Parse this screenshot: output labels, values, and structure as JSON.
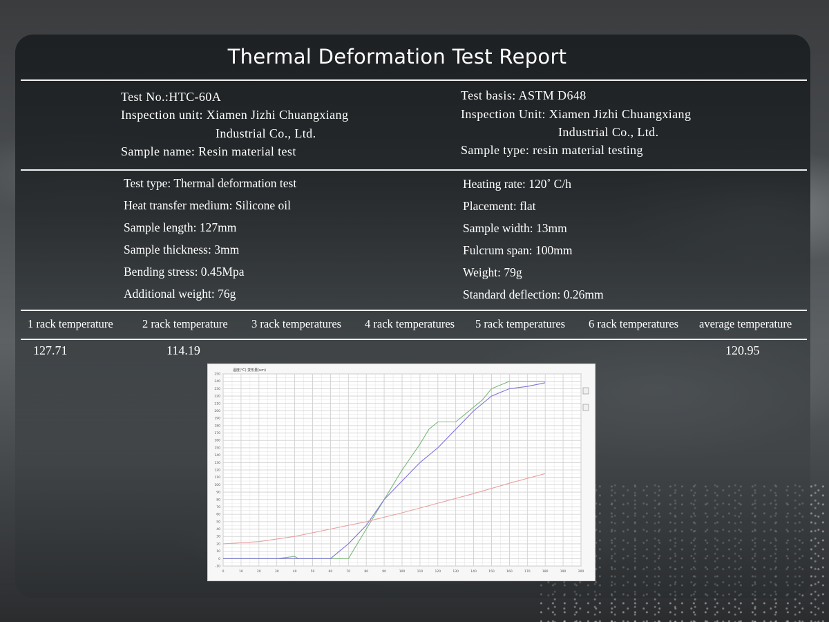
{
  "report": {
    "title": "Thermal Deformation Test Report",
    "header_left": {
      "test_no": "Test No.:HTC-60A",
      "inspection_unit_1": "Inspection unit: Xiamen Jizhi Chuangxiang",
      "inspection_unit_2": "Industrial Co., Ltd.",
      "sample_name": "Sample name: Resin material test"
    },
    "header_right": {
      "test_basis": "Test basis: ASTM D648",
      "inspection_unit_1": "Inspection Unit: Xiamen Jizhi Chuangxiang",
      "inspection_unit_2": "Industrial Co., Ltd.",
      "sample_type": "Sample type: resin material testing"
    },
    "params_left": [
      "Test type: Thermal deformation test",
      "Heat transfer medium: Silicone oil",
      "Sample length: 127mm",
      "Sample thickness: 3mm",
      "Bending stress: 0.45Mpa",
      "Additional weight: 76g"
    ],
    "params_right": [
      "Heating rate: 120˚ C/h",
      "Placement: flat",
      "Sample width: 13mm",
      "Fulcrum span: 100mm",
      "Weight: 79g",
      "Standard deflection: 0.26mm"
    ],
    "temperature_columns": [
      "1 rack temperature",
      "2 rack temperature",
      "3 rack temperatures",
      "4 rack temperatures",
      "5 rack temperatures",
      "6 rack temperatures",
      "average temperature"
    ],
    "temperature_values": {
      "rack1": "127.71",
      "rack2": "114.19",
      "average": "120.95"
    }
  },
  "chart_data": {
    "type": "line",
    "title": "温度(℃) 变形量(um)",
    "xlim": [
      0,
      200
    ],
    "ylim": [
      -10,
      250
    ],
    "x_ticks": [
      "0",
      "10",
      "20",
      "30",
      "40",
      "50",
      "60",
      "70",
      "80",
      "90",
      "100",
      "110",
      "120",
      "130",
      "140",
      "150",
      "160",
      "170",
      "180",
      "190",
      "200"
    ],
    "y_ticks": [
      "-10",
      "0",
      "10",
      "20",
      "30",
      "40",
      "50",
      "60",
      "70",
      "80",
      "90",
      "100",
      "110",
      "120",
      "130",
      "140",
      "150",
      "160",
      "170",
      "180",
      "190",
      "200",
      "210",
      "220",
      "230",
      "240",
      "250"
    ],
    "series": [
      {
        "color": "#7ab77a",
        "x": [
          0,
          30,
          40,
          42,
          60,
          70,
          80,
          90,
          100,
          110,
          115,
          120,
          130,
          140,
          145,
          150,
          160,
          170,
          180
        ],
        "y": [
          0,
          0,
          3,
          0,
          0,
          0,
          40,
          80,
          120,
          155,
          175,
          185,
          185,
          205,
          215,
          230,
          240,
          240,
          240
        ]
      },
      {
        "color": "#7d74d6",
        "x": [
          0,
          60,
          65,
          70,
          80,
          90,
          100,
          110,
          120,
          130,
          140,
          150,
          160,
          170,
          180
        ],
        "y": [
          0,
          0,
          10,
          20,
          45,
          80,
          105,
          130,
          150,
          175,
          200,
          220,
          230,
          233,
          238
        ]
      },
      {
        "color": "#e8a0a0",
        "x": [
          0,
          20,
          40,
          60,
          80,
          100,
          120,
          140,
          160,
          180
        ],
        "y": [
          20,
          23,
          30,
          40,
          50,
          62,
          75,
          88,
          102,
          115
        ]
      }
    ],
    "right_icons": [
      "chart-zoom-icon",
      "chart-export-icon"
    ]
  }
}
